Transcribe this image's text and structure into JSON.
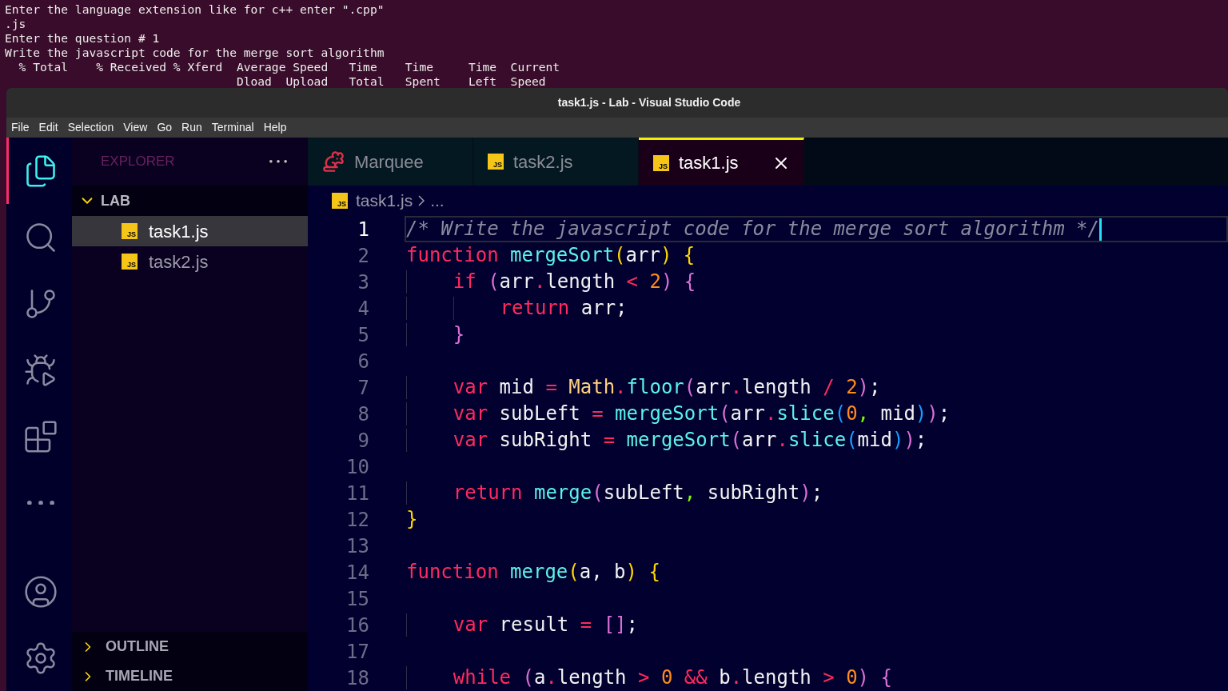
{
  "terminal": {
    "lines": [
      "Enter the language extension like for c++ enter \".cpp\"",
      ".js",
      "Enter the question # 1",
      "Write the javascript code for the merge sort algorithm",
      "  % Total    % Received % Xferd  Average Speed   Time    Time     Time  Current",
      "                                 Dload  Upload   Total   Spent    Left  Speed"
    ]
  },
  "window": {
    "title": "task1.js - Lab - Visual Studio Code"
  },
  "menu": [
    "File",
    "Edit",
    "Selection",
    "View",
    "Go",
    "Run",
    "Terminal",
    "Help"
  ],
  "activity_bar": [
    {
      "kind": "files",
      "selected": true
    },
    {
      "kind": "search",
      "selected": false
    },
    {
      "kind": "source-control",
      "selected": false
    },
    {
      "kind": "debug",
      "selected": false
    },
    {
      "kind": "extensions",
      "selected": false
    },
    {
      "kind": "more",
      "selected": false
    },
    {
      "kind": "account",
      "selected": false
    },
    {
      "kind": "settings",
      "selected": false
    }
  ],
  "sidebar": {
    "title": "EXPLORER",
    "folder": {
      "name": "LAB",
      "expanded": true,
      "files": [
        {
          "name": "task1.js",
          "badge": "JS",
          "selected": true
        },
        {
          "name": "task2.js",
          "badge": "JS",
          "selected": false
        }
      ]
    },
    "sections": [
      {
        "name": "OUTLINE",
        "expanded": false
      },
      {
        "name": "TIMELINE",
        "expanded": false
      }
    ]
  },
  "tabs": [
    {
      "label": "Marquee",
      "kind": "marquee",
      "selected": false
    },
    {
      "label": "task2.js",
      "kind": "js",
      "badge": "JS",
      "selected": false
    },
    {
      "label": "task1.js",
      "kind": "js",
      "badge": "JS",
      "selected": true
    }
  ],
  "breadcrumb": {
    "badge": "JS",
    "file": "task1.js",
    "rest": "..."
  },
  "code": [
    {
      "number": "1",
      "current": true,
      "tokens": [
        {
          "kind": "comment",
          "text": "/* Write the javascript code for the merge sort algorithm */"
        }
      ]
    },
    {
      "number": "2",
      "current": false,
      "tokens": [
        {
          "kind": "kw",
          "text": "function"
        },
        {
          "kind": "fn",
          "text": " mergeSort"
        },
        {
          "kind": "b1",
          "text": "("
        },
        {
          "kind": "id",
          "text": "arr"
        },
        {
          "kind": "b1",
          "text": ")"
        },
        {
          "kind": "b1",
          "text": " {"
        }
      ]
    },
    {
      "number": "3",
      "current": false,
      "tokens": [
        {
          "kind": "kw",
          "text": "    if"
        },
        {
          "kind": "b2",
          "text": " ("
        },
        {
          "kind": "id",
          "text": "arr"
        },
        {
          "kind": "op",
          "text": "."
        },
        {
          "kind": "id",
          "text": "length "
        },
        {
          "kind": "op",
          "text": "<"
        },
        {
          "kind": "num",
          "text": " 2"
        },
        {
          "kind": "b2",
          "text": ")"
        },
        {
          "kind": "b2",
          "text": " {"
        }
      ]
    },
    {
      "number": "4",
      "current": false,
      "tokens": [
        {
          "kind": "kw",
          "text": "        return"
        },
        {
          "kind": "id",
          "text": " arr;"
        }
      ]
    },
    {
      "number": "5",
      "current": false,
      "tokens": [
        {
          "kind": "b2",
          "text": "    }"
        }
      ]
    },
    {
      "number": "6",
      "current": false
    },
    {
      "number": "7",
      "current": false,
      "tokens": [
        {
          "kind": "kw",
          "text": "    var"
        },
        {
          "kind": "id",
          "text": " mid "
        },
        {
          "kind": "op",
          "text": "="
        },
        {
          "kind": "cls",
          "text": " Math"
        },
        {
          "kind": "op",
          "text": "."
        },
        {
          "kind": "fn",
          "text": "floor"
        },
        {
          "kind": "b2",
          "text": "("
        },
        {
          "kind": "id",
          "text": "arr"
        },
        {
          "kind": "op",
          "text": "."
        },
        {
          "kind": "id",
          "text": "length "
        },
        {
          "kind": "op",
          "text": "/"
        },
        {
          "kind": "num",
          "text": " 2"
        },
        {
          "kind": "b2",
          "text": ")"
        },
        {
          "kind": "id",
          "text": ";"
        }
      ]
    },
    {
      "number": "8",
      "current": false,
      "tokens": [
        {
          "kind": "kw",
          "text": "    var"
        },
        {
          "kind": "id",
          "text": " subLeft "
        },
        {
          "kind": "op",
          "text": "="
        },
        {
          "kind": "fn",
          "text": " mergeSort"
        },
        {
          "kind": "b2",
          "text": "("
        },
        {
          "kind": "id",
          "text": "arr"
        },
        {
          "kind": "op",
          "text": "."
        },
        {
          "kind": "fn",
          "text": "slice"
        },
        {
          "kind": "b3",
          "text": "("
        },
        {
          "kind": "num",
          "text": "0"
        },
        {
          "kind": "sep",
          "text": ","
        },
        {
          "kind": "id",
          "text": " mid"
        },
        {
          "kind": "b3",
          "text": ")"
        },
        {
          "kind": "b2",
          "text": ")"
        },
        {
          "kind": "id",
          "text": ";"
        }
      ]
    },
    {
      "number": "9",
      "current": false,
      "tokens": [
        {
          "kind": "kw",
          "text": "    var"
        },
        {
          "kind": "id",
          "text": " subRight "
        },
        {
          "kind": "op",
          "text": "="
        },
        {
          "kind": "fn",
          "text": " mergeSort"
        },
        {
          "kind": "b2",
          "text": "("
        },
        {
          "kind": "id",
          "text": "arr"
        },
        {
          "kind": "op",
          "text": "."
        },
        {
          "kind": "fn",
          "text": "slice"
        },
        {
          "kind": "b3",
          "text": "("
        },
        {
          "kind": "id",
          "text": "mid"
        },
        {
          "kind": "b3",
          "text": ")"
        },
        {
          "kind": "b2",
          "text": ")"
        },
        {
          "kind": "id",
          "text": ";"
        }
      ]
    },
    {
      "number": "10",
      "current": false
    },
    {
      "number": "11",
      "current": false,
      "tokens": [
        {
          "kind": "kw",
          "text": "    return"
        },
        {
          "kind": "fn",
          "text": " merge"
        },
        {
          "kind": "b2",
          "text": "("
        },
        {
          "kind": "id",
          "text": "subLeft"
        },
        {
          "kind": "sep",
          "text": ","
        },
        {
          "kind": "id",
          "text": " subRight"
        },
        {
          "kind": "b2",
          "text": ")"
        },
        {
          "kind": "id",
          "text": ";"
        }
      ]
    },
    {
      "number": "12",
      "current": false,
      "tokens": [
        {
          "kind": "b1",
          "text": "}"
        }
      ]
    },
    {
      "number": "13",
      "current": false
    },
    {
      "number": "14",
      "current": false,
      "tokens": [
        {
          "kind": "kw",
          "text": "function"
        },
        {
          "kind": "fn",
          "text": " merge"
        },
        {
          "kind": "b1",
          "text": "("
        },
        {
          "kind": "id",
          "text": "a, b"
        },
        {
          "kind": "b1",
          "text": ")"
        },
        {
          "kind": "b1",
          "text": " {"
        }
      ]
    },
    {
      "number": "15",
      "current": false
    },
    {
      "number": "16",
      "current": false,
      "tokens": [
        {
          "kind": "kw",
          "text": "    var"
        },
        {
          "kind": "id",
          "text": " result "
        },
        {
          "kind": "op",
          "text": "="
        },
        {
          "kind": "b2",
          "text": " []"
        },
        {
          "kind": "id",
          "text": ";"
        }
      ]
    },
    {
      "number": "17",
      "current": false
    },
    {
      "number": "18",
      "current": false,
      "tokens": [
        {
          "kind": "kw",
          "text": "    while"
        },
        {
          "kind": "b2",
          "text": " ("
        },
        {
          "kind": "id",
          "text": "a"
        },
        {
          "kind": "op",
          "text": "."
        },
        {
          "kind": "id",
          "text": "length "
        },
        {
          "kind": "op",
          "text": ">"
        },
        {
          "kind": "num",
          "text": " 0"
        },
        {
          "kind": "op",
          "text": " &&"
        },
        {
          "kind": "id",
          "text": " b"
        },
        {
          "kind": "op",
          "text": "."
        },
        {
          "kind": "id",
          "text": "length "
        },
        {
          "kind": "op",
          "text": ">"
        },
        {
          "kind": "num",
          "text": " 0"
        },
        {
          "kind": "b2",
          "text": ")"
        },
        {
          "kind": "b2",
          "text": " {"
        }
      ]
    }
  ]
}
